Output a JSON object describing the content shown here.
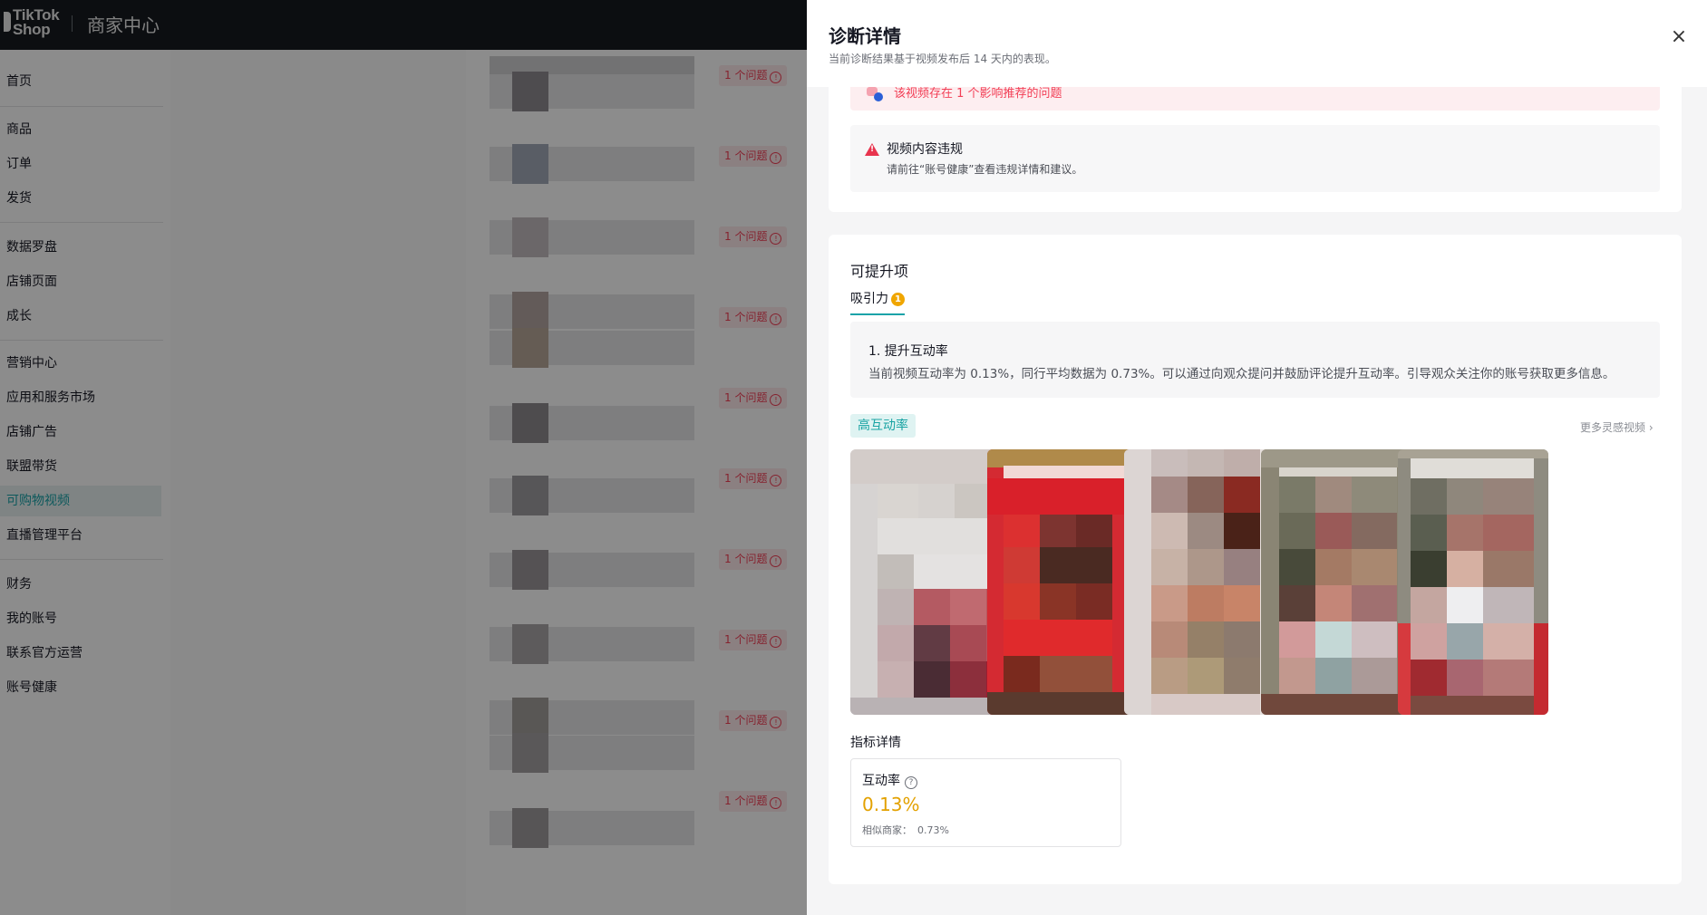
{
  "app": {
    "logo_text": "TikTok\nShop",
    "name": "商家中心"
  },
  "sidebar": {
    "items": [
      {
        "label": "首页"
      },
      {
        "label": "商品"
      },
      {
        "label": "订单"
      },
      {
        "label": "发货"
      },
      {
        "label": "数据罗盘"
      },
      {
        "label": "店铺页面"
      },
      {
        "label": "成长"
      },
      {
        "label": "营销中心"
      },
      {
        "label": "应用和服务市场"
      },
      {
        "label": "店铺广告"
      },
      {
        "label": "联盟带货"
      },
      {
        "label": "可购物视频",
        "active": true
      },
      {
        "label": "直播管理平台"
      },
      {
        "label": "财务"
      },
      {
        "label": "我的账号"
      },
      {
        "label": "联系官方运营"
      },
      {
        "label": "账号健康"
      }
    ]
  },
  "list": {
    "issue_label": "1 个问题",
    "issue_icon": "info-icon"
  },
  "drawer": {
    "title": "诊断详情",
    "subtitle": "当前诊断结果基于视频发布后 14 天内的表现。",
    "close_icon": "close-icon",
    "diagnosis": {
      "pink_row_text": "该视频存在 1 个影响推荐的问题",
      "violation": {
        "icon": "warning-icon",
        "title": "视频内容违规",
        "desc": "请前往“账号健康”查看违规详情和建议。"
      }
    },
    "improve": {
      "title": "可提升项",
      "tab": {
        "label": "吸引力",
        "badge": "1"
      },
      "tip": {
        "title": "1. 提升互动率",
        "desc": "当前视频互动率为 0.13%，同行平均数据为 0.73%。可以通过向观众提问并鼓励评论提升互动率。引导观众关注你的账号获取更多信息。"
      },
      "tag": "高互动率",
      "more_link": "更多灵感视频 ›"
    },
    "metrics": {
      "label": "指标详情",
      "name": "互动率",
      "value": "0.13%",
      "peer_label": "相似商家：",
      "peer_value": "0.73%"
    }
  }
}
